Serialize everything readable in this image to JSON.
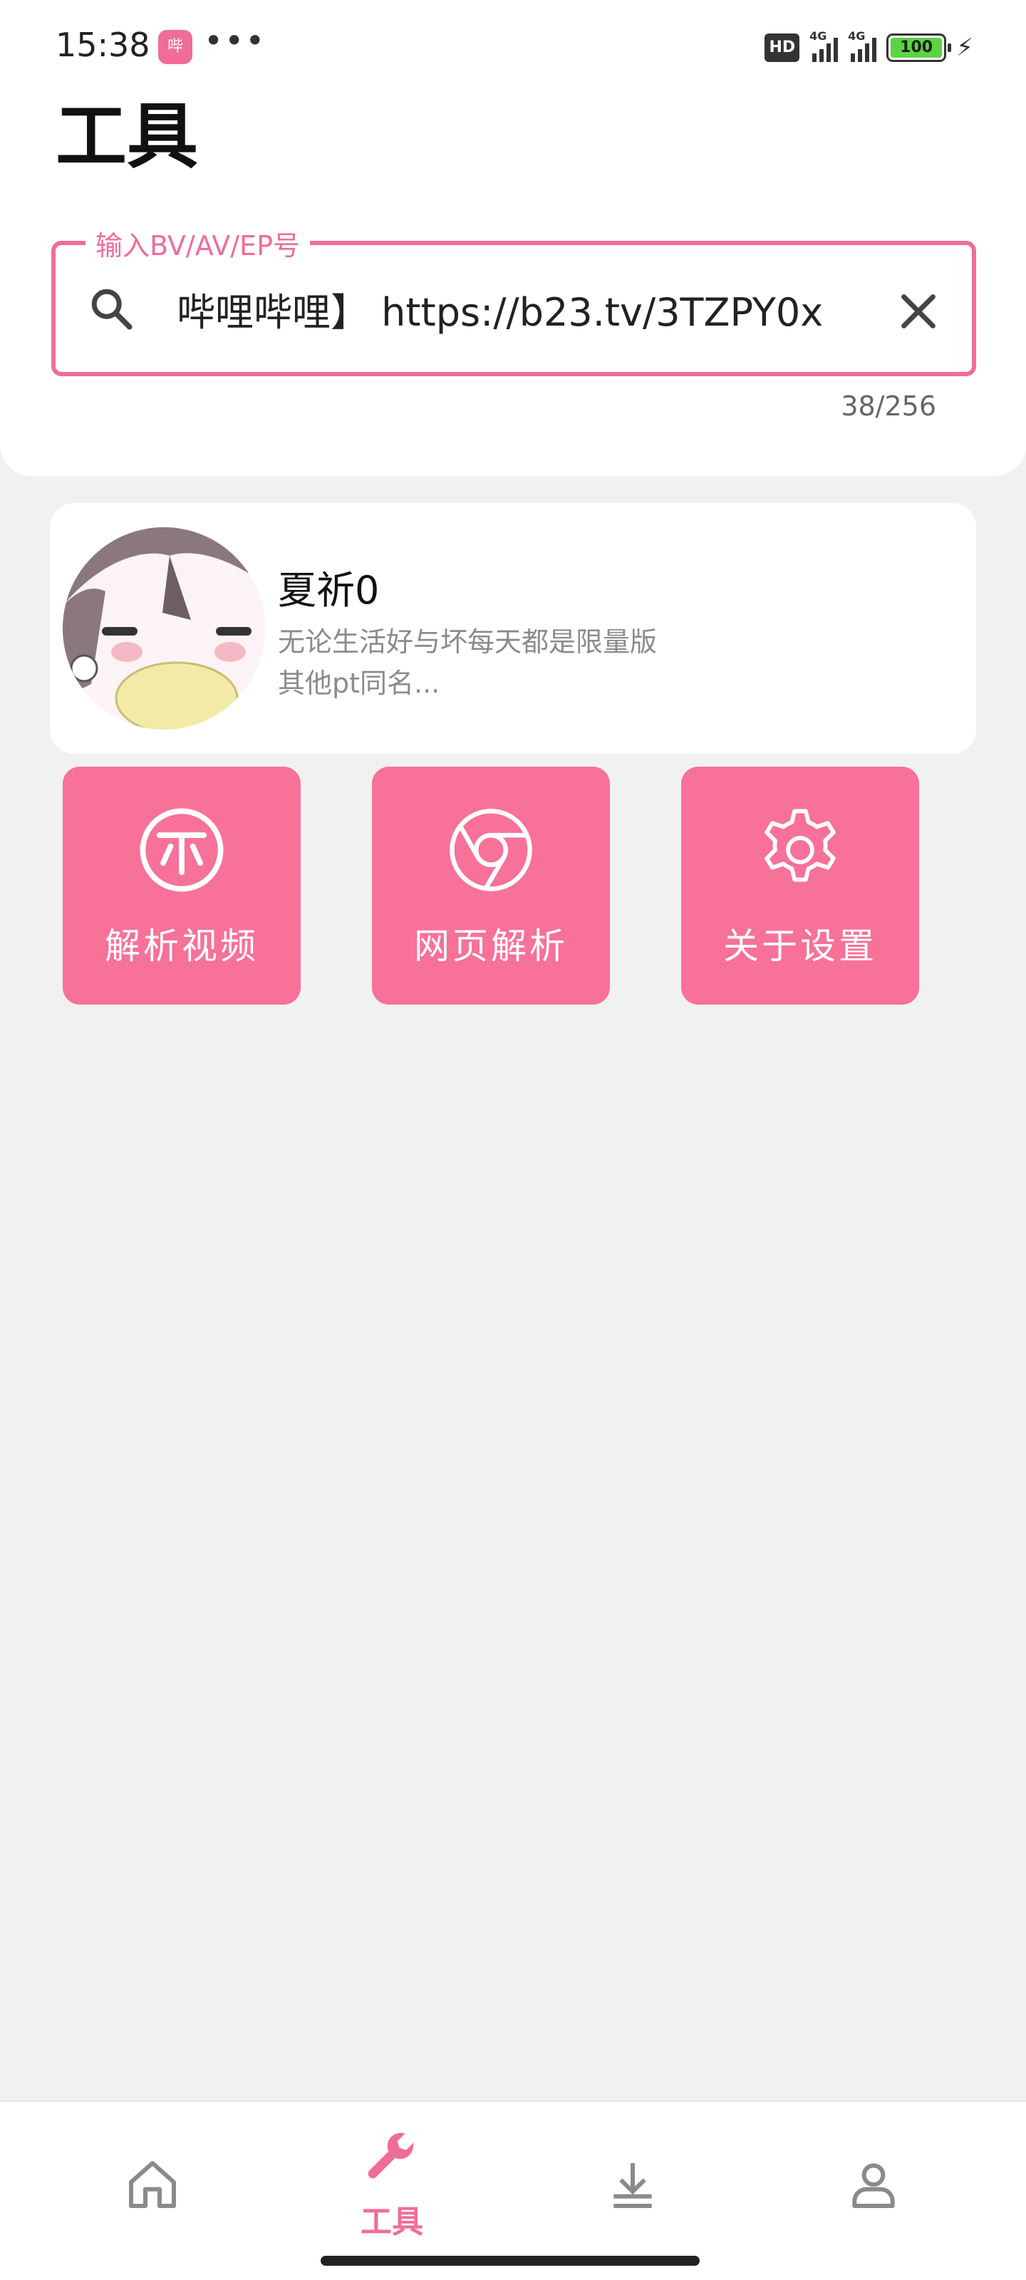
{
  "status_bar": {
    "time": "15:38",
    "app_icon_text": "哔",
    "more": "•••",
    "hd": "HD",
    "signal1": "4G",
    "signal2": "4G",
    "battery": "100"
  },
  "page": {
    "title": "工具"
  },
  "search": {
    "legend": "输入BV/AV/EP号",
    "value": "哔哩哔哩】 https://b23.tv/3TZPY0x",
    "counter": "38/256"
  },
  "profile": {
    "name": "夏祈0",
    "bio": "无论生活好与坏每天都是限量版\n其他pt同名..."
  },
  "tools": [
    {
      "label": "解析视频",
      "icon": "coin-icon"
    },
    {
      "label": "网页解析",
      "icon": "chrome-icon"
    },
    {
      "label": "关于设置",
      "icon": "gear-icon"
    }
  ],
  "bottom_nav": {
    "items": [
      {
        "icon": "home-icon",
        "label": ""
      },
      {
        "icon": "wrench-icon",
        "label": "工具",
        "active": true
      },
      {
        "icon": "download-icon",
        "label": ""
      },
      {
        "icon": "user-icon",
        "label": ""
      }
    ]
  },
  "colors": {
    "accent": "#f06d98",
    "tile": "#f77199",
    "background": "#f1f1f1"
  }
}
